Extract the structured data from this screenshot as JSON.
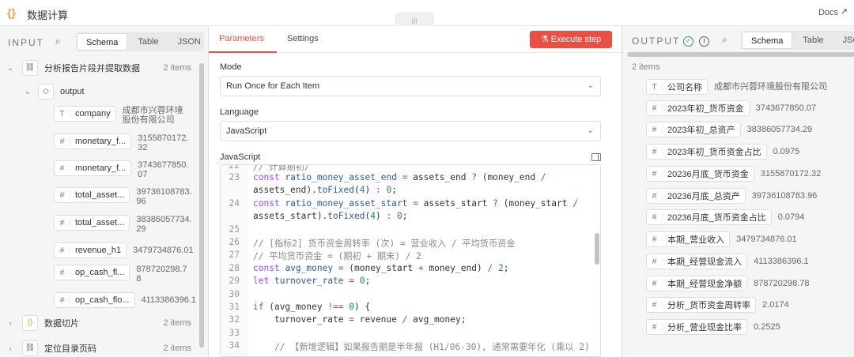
{
  "topbar": {
    "title": "数据计算",
    "docs": "Docs",
    "node_icon": "{}"
  },
  "input": {
    "label": "INPUT",
    "view_tabs": [
      "Schema",
      "Table",
      "JSON"
    ],
    "tree": [
      {
        "label": "分析报告片段并提取数据",
        "count": "2 items",
        "icon": "link-icon"
      },
      {
        "label": "output",
        "icon": "cube-icon"
      },
      {
        "label": "数据切片",
        "count": "2 items",
        "icon": "braces-icon"
      },
      {
        "label": "定位目录页码",
        "count": "2 items",
        "icon": "link-icon"
      }
    ],
    "fields": [
      {
        "type": "T",
        "name": "company",
        "value": "成都市兴蓉环境股份有限公司"
      },
      {
        "type": "#",
        "name": "monetary_f...",
        "value": "3155870172.32"
      },
      {
        "type": "#",
        "name": "monetary_f...",
        "value": "3743677850.07"
      },
      {
        "type": "#",
        "name": "total_asset...",
        "value": "39736108783.96"
      },
      {
        "type": "#",
        "name": "total_asset...",
        "value": "38386057734.29"
      },
      {
        "type": "#",
        "name": "revenue_h1",
        "value": "3479734876.01"
      },
      {
        "type": "#",
        "name": "op_cash_fl...",
        "value": "878720298.78"
      },
      {
        "type": "#",
        "name": "op_cash_flo...",
        "value": "4113386396.1"
      }
    ]
  },
  "params": {
    "tabs": [
      "Parameters",
      "Settings"
    ],
    "execute_label": "Execute step",
    "mode_label": "Mode",
    "mode_value": "Run Once for Each Item",
    "language_label": "Language",
    "language_value": "JavaScript",
    "code_label": "JavaScript"
  },
  "code_lines": [
    {
      "n": "22",
      "text": "// 计算期初/"
    },
    {
      "n": "23",
      "text": "const ratio_money_asset_end = assets_end ? (money_end /"
    },
    {
      "n": "",
      "text": "assets_end).toFixed(4) : 0;"
    },
    {
      "n": "24",
      "text": "const ratio_money_asset_start = assets_start ? (money_start /"
    },
    {
      "n": "",
      "text": "assets_start).toFixed(4) : 0;"
    },
    {
      "n": "25",
      "text": ""
    },
    {
      "n": "26",
      "text": "// [指标2] 货币资金周转率 (次) = 营业收入 / 平均货币资金"
    },
    {
      "n": "27",
      "text": "// 平均货币资金 = (期初 + 期末) / 2"
    },
    {
      "n": "28",
      "text": "const avg_money = (money_start + money_end) / 2;"
    },
    {
      "n": "29",
      "text": "let turnover_rate = 0;"
    },
    {
      "n": "30",
      "text": ""
    },
    {
      "n": "31",
      "text": "if (avg_money !== 0) {"
    },
    {
      "n": "32",
      "text": "    turnover_rate = revenue / avg_money;"
    },
    {
      "n": "33",
      "text": ""
    },
    {
      "n": "34",
      "text": "    // 【新增逻辑】如果报告期是半年报 (H1/06-30), 通常需要年化 (乘以 2)"
    }
  ],
  "output": {
    "label": "OUTPUT",
    "view_tabs": [
      "Schema",
      "Table",
      "JSON"
    ],
    "count": "2 items",
    "fields": [
      {
        "type": "T",
        "name": "公司名称",
        "value": "成都市兴蓉环境股份有限公司"
      },
      {
        "type": "#",
        "name": "2023年初_货币资金",
        "value": "3743677850.07"
      },
      {
        "type": "#",
        "name": "2023年初_总资产",
        "value": "38386057734.29"
      },
      {
        "type": "#",
        "name": "2023年初_货币资金占比",
        "value": "0.0975"
      },
      {
        "type": "#",
        "name": "20236月底_货币资金",
        "value": "3155870172.32"
      },
      {
        "type": "#",
        "name": "20236月底_总资产",
        "value": "39736108783.96"
      },
      {
        "type": "#",
        "name": "20236月底_货币资金占比",
        "value": "0.0794"
      },
      {
        "type": "#",
        "name": "本期_营业收入",
        "value": "3479734876.01"
      },
      {
        "type": "#",
        "name": "本期_经营现金流入",
        "value": "4113386396.1"
      },
      {
        "type": "#",
        "name": "本期_经营现金净额",
        "value": "878720298.78"
      },
      {
        "type": "#",
        "name": "分析_货币资金周转率",
        "value": "2.0174"
      },
      {
        "type": "#",
        "name": "分析_营业现金比率",
        "value": "0.2525"
      }
    ]
  }
}
